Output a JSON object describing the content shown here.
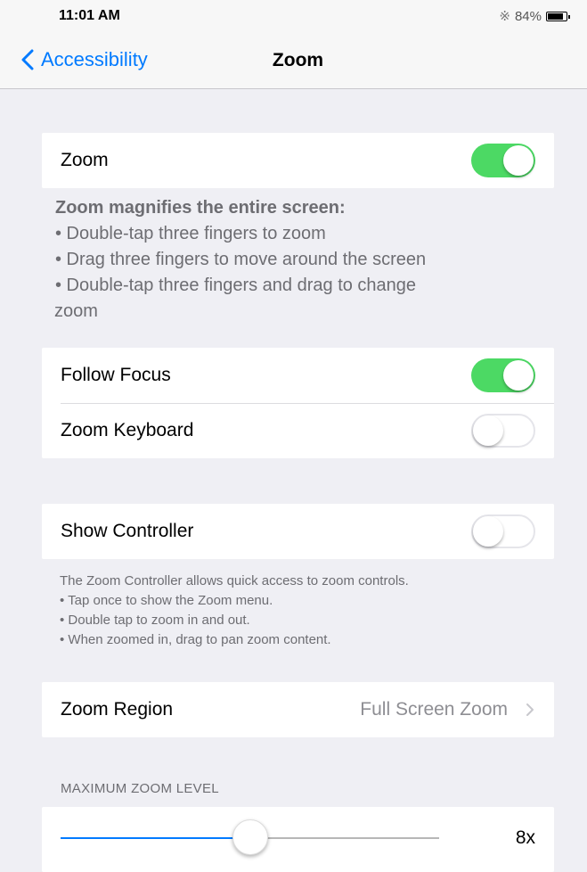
{
  "status_bar": {
    "time": "11:01 AM",
    "battery_percent": "84%",
    "battery_level": 0.84,
    "bluetooth_icon": "bluetooth-icon"
  },
  "nav": {
    "back_label": "Accessibility",
    "title": "Zoom"
  },
  "zoom_group": {
    "label": "Zoom",
    "on": true
  },
  "zoom_footer": {
    "header": "Zoom magnifies the entire screen:",
    "bullets": [
      "• Double-tap three fingers to zoom",
      "• Drag three fingers to move around the screen",
      "• Double-tap three fingers and drag to change"
    ],
    "continuation": "zoom"
  },
  "focus_group": {
    "follow_focus": {
      "label": "Follow Focus",
      "on": true
    },
    "zoom_keyboard": {
      "label": "Zoom Keyboard",
      "on": false
    }
  },
  "controller_group": {
    "label": "Show Controller",
    "on": false
  },
  "controller_footer": {
    "lines": [
      "The Zoom Controller allows quick access to zoom controls.",
      "• Tap once to show the Zoom menu.",
      "• Double tap to zoom in and out.",
      "• When zoomed in, drag to pan zoom content."
    ]
  },
  "region_group": {
    "label": "Zoom Region",
    "value": "Full Screen Zoom"
  },
  "max_zoom": {
    "header": "MAXIMUM ZOOM LEVEL",
    "value_label": "8x",
    "slider_fraction": 0.5,
    "accent_color": "#007aff"
  },
  "colors": {
    "switch_on": "#4cd964",
    "tint": "#007aff"
  }
}
